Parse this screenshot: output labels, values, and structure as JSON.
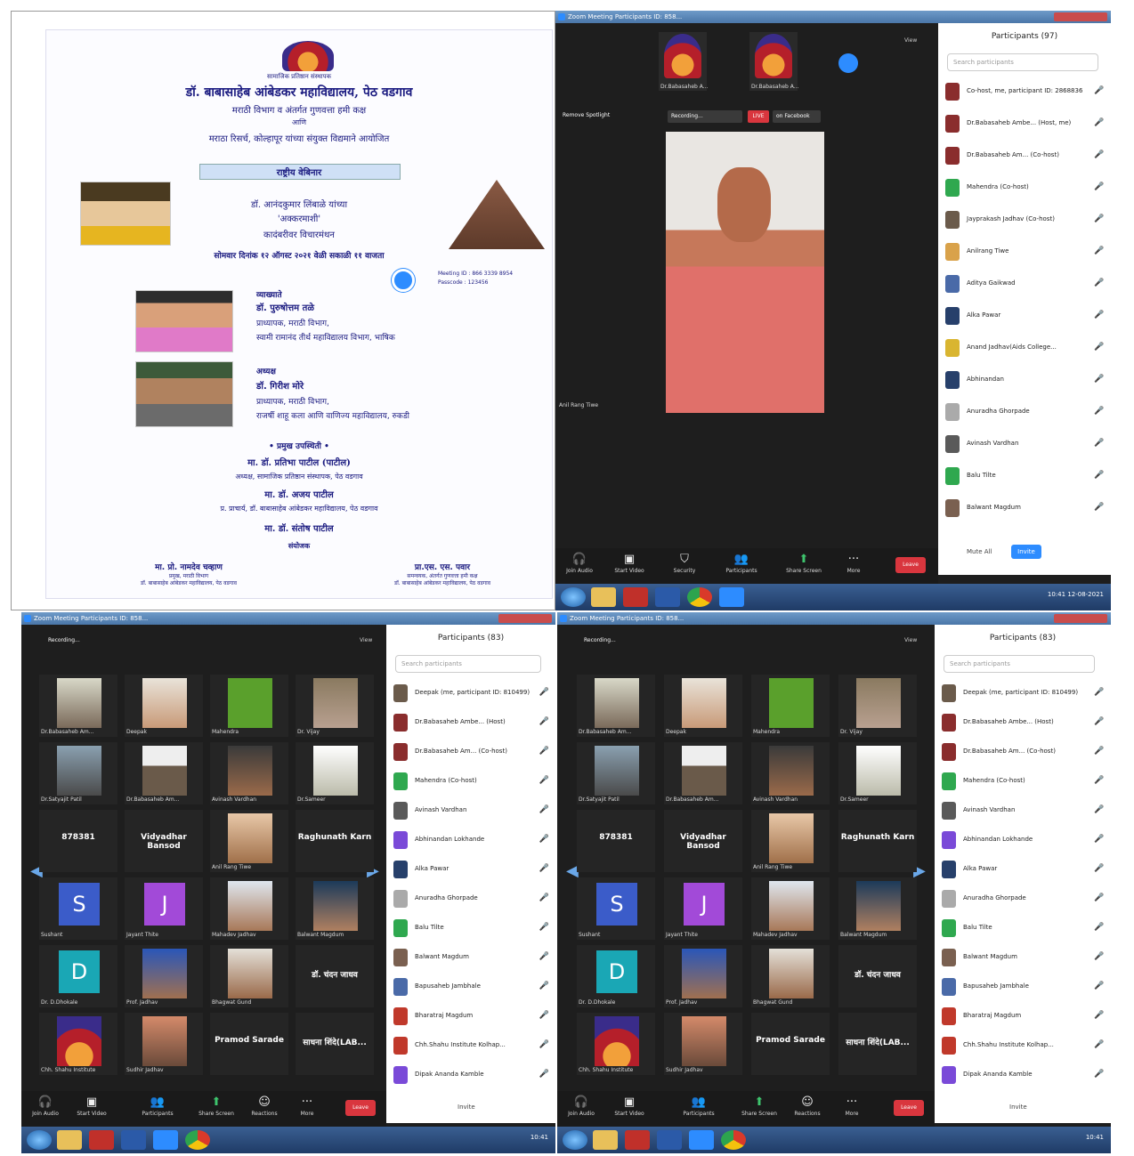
{
  "poster": {
    "line1": "सामाजिक प्रतिष्ठान संस्थापक",
    "line2": "डॉ. बाबासाहेब आंबेडकर महाविद्यालय, पेठ वडगाव",
    "line3": "मराठी विभाग व अंतर्गत गुणवत्ता हमी कक्ष",
    "line4": "आणि",
    "line5": "मराठा रिसर्च, कोल्हापूर यांच्या संयुक्त विद्यमाने आयोजित",
    "box": "राष्ट्रीय वेबिनार",
    "title1": "डॉ. आनंदकुमार लिंबाळे यांच्या",
    "title2": "'अक्करमाशी'",
    "title3": "कादंबरीवर विचारमंथन",
    "date_line": "सोमवार दिनांक १२ ऑगस्ट २०२१ वेळी सकाळी ११ वाजता",
    "meeting_id": "Meeting ID : 866 3339 8954",
    "passcode": "Passcode : 123456",
    "speaker_role": "व्याख्याते",
    "speaker_name": "डॉ. पुरुषोत्तम तळे",
    "speaker_dept": "प्राध्यापक, मराठी विभाग,",
    "speaker_college": "स्वामी रामानंद तीर्थ महाविद्यालय विभाग, भाषिक",
    "chair_role": "अध्यक्ष",
    "chair_name": "डॉ. गिरीश मोरे",
    "chair_dept": "प्राध्यापक, मराठी विभाग,",
    "chair_college": "राजर्षी शाहू कला आणि वाणिज्य महाविद्यालय, रुकडी",
    "guests_heading": "• प्रमुख उपस्थिती •",
    "guest1": "मा. डॉ. प्रतिभा पाटील (पाटील)",
    "guest1_role": "अध्यक्ष, सामाजिक प्रतिष्ठान संस्थापक, पेठ वडगाव",
    "guest2": "मा. डॉ. अजय पाटील",
    "guest2_role": "प्र. प्राचार्य, डॉ. बाबासाहेब आंबेडकर महाविद्यालय, पेठ वडगाव",
    "guest3": "मा. डॉ. संतोष पाटील",
    "organisers": "संयोजक",
    "org1_name": "मा. प्रो. नामदेव चव्हाण",
    "org1_role": "प्रमुख, मराठी विभाग",
    "org1_college": "डॉ. बाबासाहेब आंबेडकर महाविद्यालय, पेठ वडगाव",
    "org2_name": "प्रा.एस. एस. पवार",
    "org2_role": "समन्वयक, अंतर्गत गुणवत्ता हमी कक्ष",
    "org2_college": "डॉ. बाबासाहेब आंबेडकर महाविद्यालय, पेठ वडगाव"
  },
  "win_tr": {
    "title": "Zoom Meeting Participants ID: 858...",
    "view": "View",
    "top_names": [
      "Dr.Babasaheb A...",
      "Dr.Babasaheb A..."
    ],
    "spotlight": "Remove Spotlight",
    "recording": "Recording...",
    "live": "LIVE",
    "live_label": "on Facebook",
    "speaker_label": "Anil Rang Tiwe",
    "sidebar_title": "Participants (97)",
    "search": "Search participants",
    "participants": [
      {
        "name": "Co-host, me, participant ID: 2868836",
        "color": "#8a2d2d"
      },
      {
        "name": "Dr.Babasaheb Ambe... (Host, me)",
        "color": "#8a2d2d"
      },
      {
        "name": "Dr.Babasaheb Am... (Co-host)",
        "color": "#8a2d2d"
      },
      {
        "name": "Mahendra (Co-host)",
        "color": "#2fa84f"
      },
      {
        "name": "Jayprakash Jadhav (Co-host)",
        "color": "#6b5b4b"
      },
      {
        "name": "Anilrang Tiwe",
        "color": "#d9a24a"
      },
      {
        "name": "Aditya Gaikwad",
        "color": "#4a6aa8"
      },
      {
        "name": "Alka Pawar",
        "color": "#27406b"
      },
      {
        "name": "Anand Jadhav(Aids College...",
        "color": "#d9b530"
      },
      {
        "name": "Abhinandan",
        "color": "#27406b"
      },
      {
        "name": "Anuradha Ghorpade",
        "color": "#aaaaaa"
      },
      {
        "name": "Avinash Vardhan",
        "color": "#5a5a5a"
      },
      {
        "name": "Balu Tilte",
        "color": "#2fa84f"
      },
      {
        "name": "Balwant Magdum",
        "color": "#7a6050"
      }
    ],
    "mute_all": "Mute All",
    "invite": "Invite",
    "toolbar": [
      "Join Audio",
      "Start Video",
      "Security",
      "Participants",
      "Share Screen",
      "More"
    ],
    "leave": "Leave"
  },
  "win_bl": {
    "title": "Zoom Meeting Participants ID: 858...",
    "recording": "Recording...",
    "view": "View",
    "tiles": [
      "Dr.Babasaheb Am...",
      "Deepak",
      "Mahendra",
      "Dr. Vijay",
      "Dr.Satyajit Patil",
      "Dr.Babasaheb Am...",
      "Avinash Vardhan",
      "Dr.Sameer",
      "878381",
      "Vidyadhar Bansod",
      "Anil Rang Tiwe",
      "Raghunath Karn",
      "Sushant",
      "Jayant Thite",
      "Mahadev Jadhav",
      "Balwant Magdum",
      "Dr. D.Dhokale",
      "Prof. Jadhav",
      "Bhagwat Gund",
      "डॉ. चंदन जाधव",
      "Chh. Shahu Institute",
      "Sudhir Jadhav",
      "Pramod Sarade",
      "साधना शिंदे(LAB..."
    ],
    "big_names": [
      "878381",
      "Vidyadhar Bansod",
      "Raghunath Karn",
      "डॉ. चंदन जाधव",
      "Pramod Sarade",
      "साधना शिंदे(LAB..."
    ],
    "sidebar_title": "Participants (83)",
    "search": "Search participants",
    "participants": [
      {
        "name": "Deepak (me, participant ID: 810499)",
        "color": "#6b5b4b"
      },
      {
        "name": "Dr.Babasaheb Ambe... (Host)",
        "color": "#8a2d2d"
      },
      {
        "name": "Dr.Babasaheb Am... (Co-host)",
        "color": "#8a2d2d"
      },
      {
        "name": "Mahendra (Co-host)",
        "color": "#2fa84f"
      },
      {
        "name": "Avinash Vardhan",
        "color": "#5a5a5a"
      },
      {
        "name": "Abhinandan Lokhande",
        "color": "#7a4ad8"
      },
      {
        "name": "Alka Pawar",
        "color": "#27406b"
      },
      {
        "name": "Anuradha Ghorpade",
        "color": "#aaaaaa"
      },
      {
        "name": "Balu Tilte",
        "color": "#2fa84f"
      },
      {
        "name": "Balwant Magdum",
        "color": "#7a6050"
      },
      {
        "name": "Bapusaheb Jambhale",
        "color": "#4a6aa8"
      },
      {
        "name": "Bharatraj Magdum",
        "color": "#c0392b"
      },
      {
        "name": "Chh.Shahu Institute Kolhap...",
        "color": "#c0392b"
      },
      {
        "name": "Dipak Ananda Kamble",
        "color": "#7a4ad8"
      }
    ],
    "mute_all": "Invite",
    "toolbar": [
      "Join Audio",
      "Start Video",
      "Participants",
      "Share Screen",
      "Reactions",
      "More"
    ],
    "leave": "Leave"
  },
  "win_br": {
    "title": "Zoom Meeting Participants ID: 858...",
    "recording": "Recording...",
    "view": "View",
    "tiles": [
      "Dr.Babasaheb Am...",
      "Deepak",
      "Mahendra",
      "Dr. Vijay",
      "Dr.Satyajit Patil",
      "Dr.Babasaheb Am...",
      "Avinash Vardhan",
      "Dr.Sameer",
      "878381",
      "Vidyadhar Bansod",
      "Anil Rang Tiwe",
      "Raghunath Karn",
      "Sushant",
      "Jayant Thite",
      "Mahadev Jadhav",
      "Balwant Magdum",
      "Dr. D.Dhokale",
      "Prof. Jadhav",
      "Bhagwat Gund",
      "डॉ. चंदन जाधव",
      "Chh. Shahu Institute",
      "Sudhir Jadhav",
      "Pramod Sarade",
      "साधना शिंदे(LAB..."
    ],
    "sidebar_title": "Participants (83)",
    "search": "Search participants",
    "participants": [
      {
        "name": "Deepak (me, participant ID: 810499)",
        "color": "#6b5b4b"
      },
      {
        "name": "Dr.Babasaheb Ambe... (Host)",
        "color": "#8a2d2d"
      },
      {
        "name": "Dr.Babasaheb Am... (Co-host)",
        "color": "#8a2d2d"
      },
      {
        "name": "Mahendra (Co-host)",
        "color": "#2fa84f"
      },
      {
        "name": "Avinash Vardhan",
        "color": "#5a5a5a"
      },
      {
        "name": "Abhinandan Lokhande",
        "color": "#7a4ad8"
      },
      {
        "name": "Alka Pawar",
        "color": "#27406b"
      },
      {
        "name": "Anuradha Ghorpade",
        "color": "#aaaaaa"
      },
      {
        "name": "Balu Tilte",
        "color": "#2fa84f"
      },
      {
        "name": "Balwant Magdum",
        "color": "#7a6050"
      },
      {
        "name": "Bapusaheb Jambhale",
        "color": "#4a6aa8"
      },
      {
        "name": "Bharatraj Magdum",
        "color": "#c0392b"
      },
      {
        "name": "Chh.Shahu Institute Kolhap...",
        "color": "#c0392b"
      },
      {
        "name": "Dipak Ananda Kamble",
        "color": "#7a4ad8"
      }
    ],
    "mute_all": "Invite",
    "toolbar": [
      "Join Audio",
      "Start Video",
      "Participants",
      "Share Screen",
      "Reactions",
      "More"
    ],
    "leave": "Leave"
  },
  "taskbar": {
    "time": "10:41",
    "date": "12-08-2021"
  },
  "colors": {
    "zoom_blue": "#2d8cff",
    "leave_red": "#d9363e",
    "poster_text": "#1a1a80"
  }
}
